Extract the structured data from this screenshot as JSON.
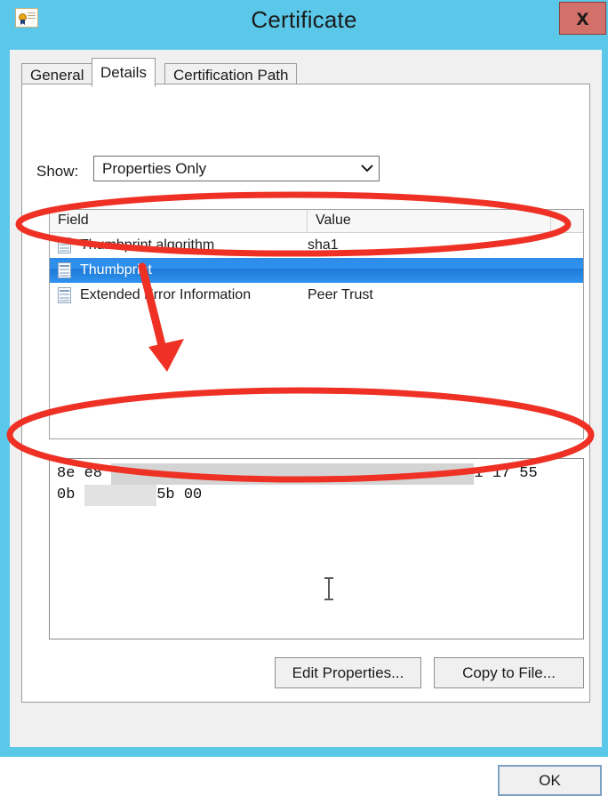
{
  "window": {
    "title": "Certificate",
    "icon": "certificate-icon",
    "close_label": "x",
    "titlebar_color": "#5BC8EA",
    "close_button_color": "#D4706A"
  },
  "tabs": [
    {
      "label": "General",
      "active": false
    },
    {
      "label": "Details",
      "active": true
    },
    {
      "label": "Certification Path",
      "active": false
    }
  ],
  "show": {
    "label": "Show:",
    "value": "Properties Only",
    "chevron": "⌄"
  },
  "field_list": {
    "columns": [
      "Field",
      "Value",
      ""
    ],
    "rows": [
      {
        "field": "Thumbprint algorithm",
        "value": "sha1",
        "selected": false
      },
      {
        "field": "Thumbprint",
        "value": "",
        "selected": true
      },
      {
        "field": "Extended Error Information",
        "value": "Peer Trust",
        "selected": false
      }
    ]
  },
  "detail": {
    "line1_prefix": "8e e8 ",
    "line1_redacted": "                                        ",
    "line1_suffix": "1 17 55",
    "line2_prefix": "0b ",
    "line2_redacted": "        ",
    "line2_suffix": "5b 00"
  },
  "buttons": {
    "edit_properties": "Edit Properties...",
    "copy_to_file": "Copy to File...",
    "ok": "OK"
  },
  "annotations": {
    "color": "#EE3124",
    "ellipse_top": "highlights the Thumbprint row in the field list",
    "arrow": "points from the Thumbprint row down to the value box",
    "ellipse_bottom": "highlights the thumbprint hex value text"
  }
}
